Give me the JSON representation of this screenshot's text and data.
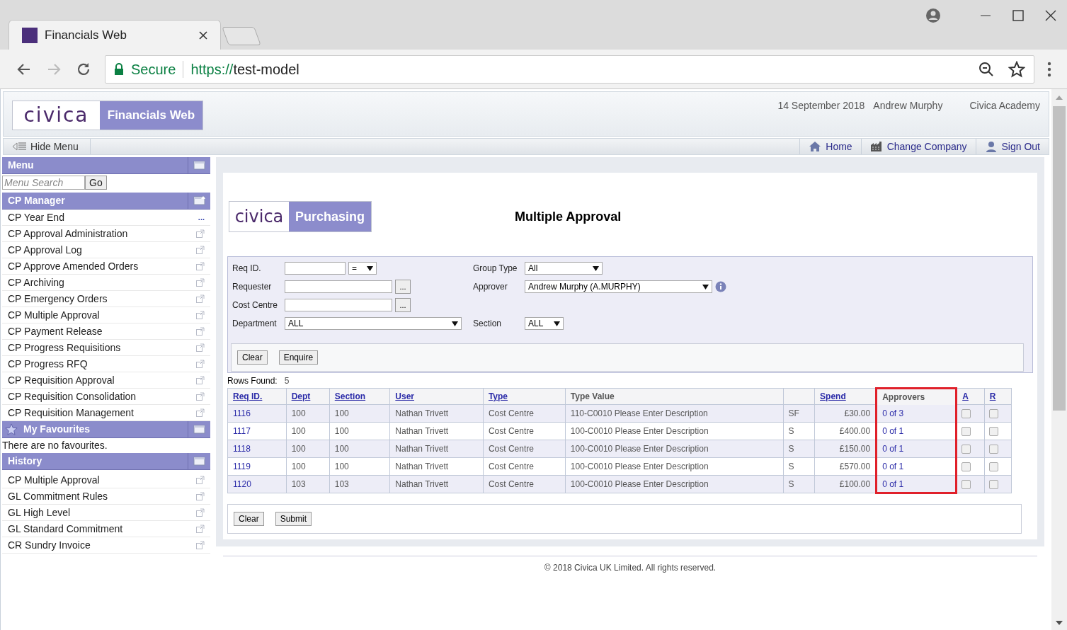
{
  "browser": {
    "tab_title": "Financials Web",
    "secure_label": "Secure",
    "url_scheme": "https://",
    "url_host": "test-model"
  },
  "header": {
    "logo": "civica",
    "product": "Financials Web",
    "date": "14 September 2018",
    "user": "Andrew Murphy",
    "company": "Civica Academy"
  },
  "nav": {
    "hide_menu": "Hide Menu",
    "links": [
      {
        "kind": "home",
        "label": "Home"
      },
      {
        "kind": "company",
        "label": "Change Company"
      },
      {
        "kind": "signout",
        "label": "Sign Out"
      }
    ]
  },
  "sidebar": {
    "menu": {
      "title": "Menu",
      "search_placeholder": "Menu Search",
      "go": "Go"
    },
    "cp_manager": {
      "title": "CP Manager",
      "items": [
        {
          "label": "CP Year End",
          "kind": "more",
          "more": "..."
        },
        {
          "label": "CP Approval Administration",
          "kind": "link"
        },
        {
          "label": "CP Approval Log",
          "kind": "link"
        },
        {
          "label": "CP Approve Amended Orders",
          "kind": "link"
        },
        {
          "label": "CP Archiving",
          "kind": "link"
        },
        {
          "label": "CP Emergency Orders",
          "kind": "link"
        },
        {
          "label": "CP Multiple Approval",
          "kind": "link"
        },
        {
          "label": "CP Payment Release",
          "kind": "link"
        },
        {
          "label": "CP Progress Requisitions",
          "kind": "link"
        },
        {
          "label": "CP Progress RFQ",
          "kind": "link"
        },
        {
          "label": "CP Requisition Approval",
          "kind": "link"
        },
        {
          "label": "CP Requisition Consolidation",
          "kind": "link"
        },
        {
          "label": "CP Requisition Management",
          "kind": "link"
        }
      ]
    },
    "favourites": {
      "title": "My Favourites",
      "empty_text": "There are no favourites."
    },
    "history": {
      "title": "History",
      "items": [
        {
          "label": "CP Multiple Approval"
        },
        {
          "label": "GL Commitment Rules"
        },
        {
          "label": "GL High Level"
        },
        {
          "label": "GL Standard Commitment"
        },
        {
          "label": "CR Sundry Invoice"
        }
      ]
    }
  },
  "main": {
    "logo": "civica",
    "module": "Purchasing",
    "title": "Multiple Approval",
    "form": {
      "req_id": {
        "label": "Req ID.",
        "operator": "="
      },
      "requester": {
        "label": "Requester",
        "lookup": "..."
      },
      "cost_centre": {
        "label": "Cost Centre",
        "lookup": "..."
      },
      "department": {
        "label": "Department",
        "value": "ALL"
      },
      "group_type": {
        "label": "Group Type",
        "value": "All"
      },
      "approver": {
        "label": "Approver",
        "value": "Andrew Murphy (A.MURPHY)"
      },
      "section": {
        "label": "Section",
        "value": "ALL"
      },
      "buttons": [
        "Clear",
        "Enquire"
      ]
    },
    "rows_found": {
      "label": "Rows Found:",
      "value": "5"
    },
    "table": {
      "columns": [
        {
          "label": "Req ID.",
          "sortable": true,
          "highlighted": false
        },
        {
          "label": "Dept",
          "sortable": true,
          "highlighted": false
        },
        {
          "label": "Section",
          "sortable": true,
          "highlighted": false
        },
        {
          "label": "User",
          "sortable": true,
          "highlighted": false
        },
        {
          "label": "Type",
          "sortable": true,
          "highlighted": false
        },
        {
          "label": "Type Value",
          "sortable": false,
          "highlighted": false
        },
        {
          "highlighted": false
        },
        {
          "label": "Spend",
          "sortable": true,
          "highlighted": false
        },
        {
          "label": "Approvers",
          "sortable": false,
          "highlighted": true
        },
        {
          "label": "A",
          "sortable": true,
          "highlighted": false
        },
        {
          "label": "R",
          "sortable": true,
          "highlighted": false
        }
      ],
      "rows": [
        {
          "req_id": "1116",
          "dept": "100",
          "section": "100",
          "user": "Nathan Trivett",
          "type": "Cost Centre",
          "type_value": "110-C0010 Please Enter Description",
          "column_7": "SF",
          "spend": "£30.00",
          "approvers": "0 of 3",
          "a_checked": false,
          "r_checked": false
        },
        {
          "req_id": "1117",
          "dept": "100",
          "section": "100",
          "user": "Nathan Trivett",
          "type": "Cost Centre",
          "type_value": "100-C0010 Please Enter Description",
          "column_7": "S",
          "spend": "£400.00",
          "approvers": "0 of 1",
          "a_checked": false,
          "r_checked": false
        },
        {
          "req_id": "1118",
          "dept": "100",
          "section": "100",
          "user": "Nathan Trivett",
          "type": "Cost Centre",
          "type_value": "100-C0010 Please Enter Description",
          "column_7": "S",
          "spend": "£150.00",
          "approvers": "0 of 1",
          "a_checked": false,
          "r_checked": false
        },
        {
          "req_id": "1119",
          "dept": "100",
          "section": "100",
          "user": "Nathan Trivett",
          "type": "Cost Centre",
          "type_value": "100-C0010 Please Enter Description",
          "column_7": "S",
          "spend": "£570.00",
          "approvers": "0 of 1",
          "a_checked": false,
          "r_checked": false
        },
        {
          "req_id": "1120",
          "dept": "103",
          "section": "103",
          "user": "Nathan Trivett",
          "type": "Cost Centre",
          "type_value": "100-C0010 Please Enter Description",
          "column_7": "S",
          "spend": "£100.00",
          "approvers": "0 of 1",
          "a_checked": false,
          "r_checked": false
        }
      ]
    },
    "bottom_buttons": [
      "Clear",
      "Submit"
    ],
    "footer": "© 2018 Civica UK Limited. All rights reserved."
  }
}
